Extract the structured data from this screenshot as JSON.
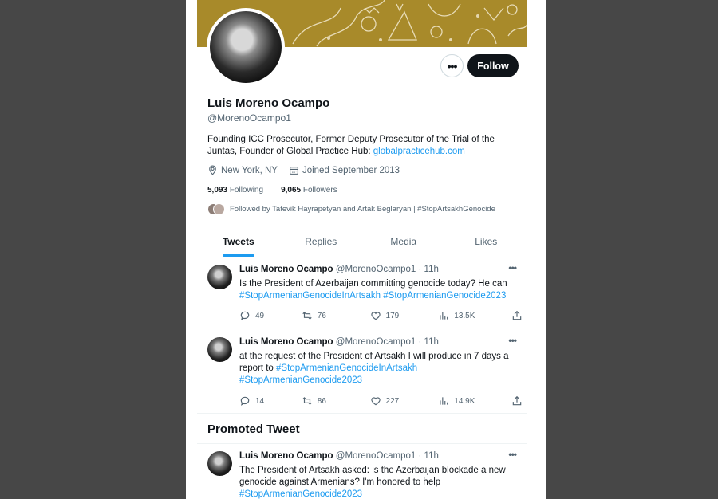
{
  "profile": {
    "name": "Luis Moreno Ocampo",
    "handle": "@MorenoOcampo1",
    "bio_text": "Founding ICC Prosecutor, Former Deputy Prosecutor of the Trial of the Juntas, Founder of Global Practice Hub: ",
    "bio_link": "globalpracticehub.com",
    "location": "New York, NY",
    "joined": "Joined September 2013",
    "following_count": "5,093",
    "following_label": "Following",
    "followers_count": "9,065",
    "followers_label": "Followers",
    "followed_by": "Followed by Tatevik Hayrapetyan and Artak Beglaryan | #StopArtsakhGenocide"
  },
  "buttons": {
    "more": "•••",
    "follow": "Follow"
  },
  "tabs": [
    {
      "label": "Tweets"
    },
    {
      "label": "Replies"
    },
    {
      "label": "Media"
    },
    {
      "label": "Likes"
    }
  ],
  "tweets": [
    {
      "name": "Luis Moreno Ocampo",
      "meta": "@MorenoOcampo1 · 11h",
      "text": "Is the President of Azerbaijan committing genocide today? He can",
      "tags": "#StopArmenianGenocideInArtsakh #StopArmenianGenocide2023",
      "replies": "49",
      "retweets": "76",
      "likes": "179",
      "views": "13.5K"
    },
    {
      "name": "Luis Moreno Ocampo",
      "meta": "@MorenoOcampo1 · 11h",
      "text": "at the request of the President of Artsakh I will produce in 7 days a report to ",
      "tag1": "#StopArmenianGenocideInArtsakh",
      "tag2": "#StopArmenianGenocide2023",
      "replies": "14",
      "retweets": "86",
      "likes": "227",
      "views": "14.9K"
    }
  ],
  "promoted_heading": "Promoted Tweet",
  "promoted_tweet": {
    "name": "Luis Moreno Ocampo",
    "meta": "@MorenoOcampo1 · 11h",
    "text": "The  President of Artsakh asked: is the Azerbaijan blockade a new genocide against Armenians? I'm honored to help",
    "tag": "#StopArmenianGenocide2023"
  },
  "icons": [
    "location-icon",
    "calendar-icon",
    "reply-icon",
    "retweet-icon",
    "like-icon",
    "views-icon",
    "share-icon",
    "more-icon"
  ],
  "colors": {
    "accent": "#1d9bf0",
    "banner": "#a88a2a",
    "follow_button": "#0f1419"
  }
}
